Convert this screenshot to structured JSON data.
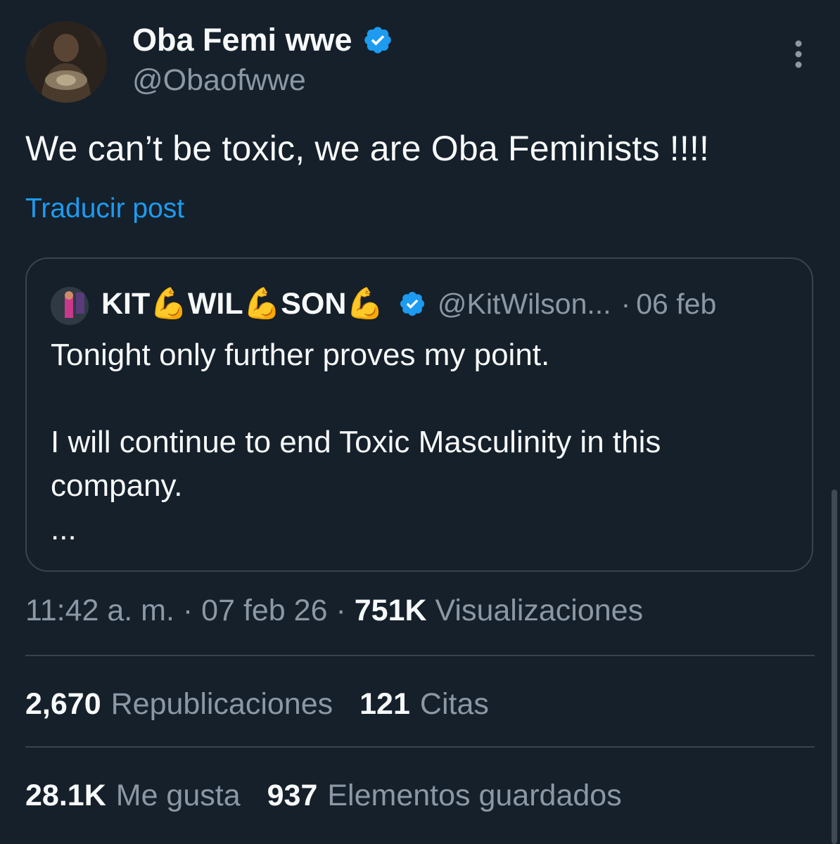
{
  "author": {
    "display_name": "Oba Femi wwe",
    "handle": "@Obaofwwe",
    "verified_icon": "verified-badge-icon",
    "avatar_icon": "avatar"
  },
  "post": {
    "text": "We can’t be toxic, we are Oba Feminists !!!!",
    "translate_label": "Traducir post"
  },
  "quote": {
    "name_parts": [
      "KIT",
      "WIL",
      "SON"
    ],
    "emoji": "💪",
    "handle": "@KitWilson...",
    "separator": "·",
    "date": "06 feb",
    "text": "Tonight only further proves my point.\n\nI will continue to end Toxic Masculinity in this company.\n...",
    "verified_icon": "verified-badge-icon"
  },
  "meta": {
    "time": "11:42 a. m.",
    "separator": "·",
    "date": "07 feb 26",
    "views_count": "751K",
    "views_label": "Visualizaciones"
  },
  "stats": {
    "reposts_count": "2,670",
    "reposts_label": "Republicaciones",
    "quotes_count": "121",
    "quotes_label": "Citas",
    "likes_count": "28.1K",
    "likes_label": "Me gusta",
    "bookmarks_count": "937",
    "bookmarks_label": "Elementos guardados"
  },
  "colors": {
    "background": "#15202b",
    "text": "#f7f9f9",
    "secondary": "#8b98a5",
    "link": "#1d9bf0",
    "border": "#38444d",
    "verified": "#1d9bf0",
    "emoji": "#f5b82e"
  }
}
